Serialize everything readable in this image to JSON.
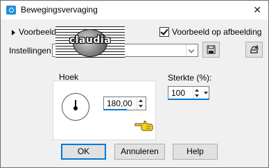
{
  "window": {
    "title": "Bewegingsvervaging"
  },
  "preview": {
    "toggle_label": "Voorbeeld",
    "checkbox_label": "Voorbeeld op afbeelding",
    "checked": true
  },
  "presets": {
    "label": "Instellingen",
    "value": "",
    "logo_text": "claudia"
  },
  "angle": {
    "group_label": "Hoek",
    "value": "180,00"
  },
  "strength": {
    "label": "Sterkte (%):",
    "value": "100"
  },
  "buttons": {
    "ok": "OK",
    "cancel": "Annuleren",
    "help": "Help"
  },
  "colors": {
    "accent": "#0078d7",
    "title_icon": "#1f8ed8"
  }
}
